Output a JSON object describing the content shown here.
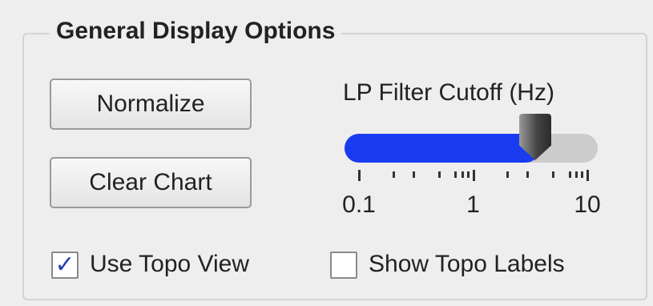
{
  "group": {
    "title": "General Display Options"
  },
  "buttons": {
    "normalize_label": "Normalize",
    "clear_chart_label": "Clear Chart"
  },
  "lp_filter": {
    "label": "LP Filter Cutoff (Hz)",
    "scale": "log",
    "min": 0.1,
    "max": 10,
    "value": 3.5,
    "tick_labels": [
      "0.1",
      "1",
      "10"
    ],
    "fill_color": "#1a3cf0"
  },
  "checkboxes": {
    "use_topo_view": {
      "label": "Use Topo View",
      "checked": true,
      "check_glyph": "✓"
    },
    "show_topo_labels": {
      "label": "Show Topo Labels",
      "checked": false
    }
  }
}
